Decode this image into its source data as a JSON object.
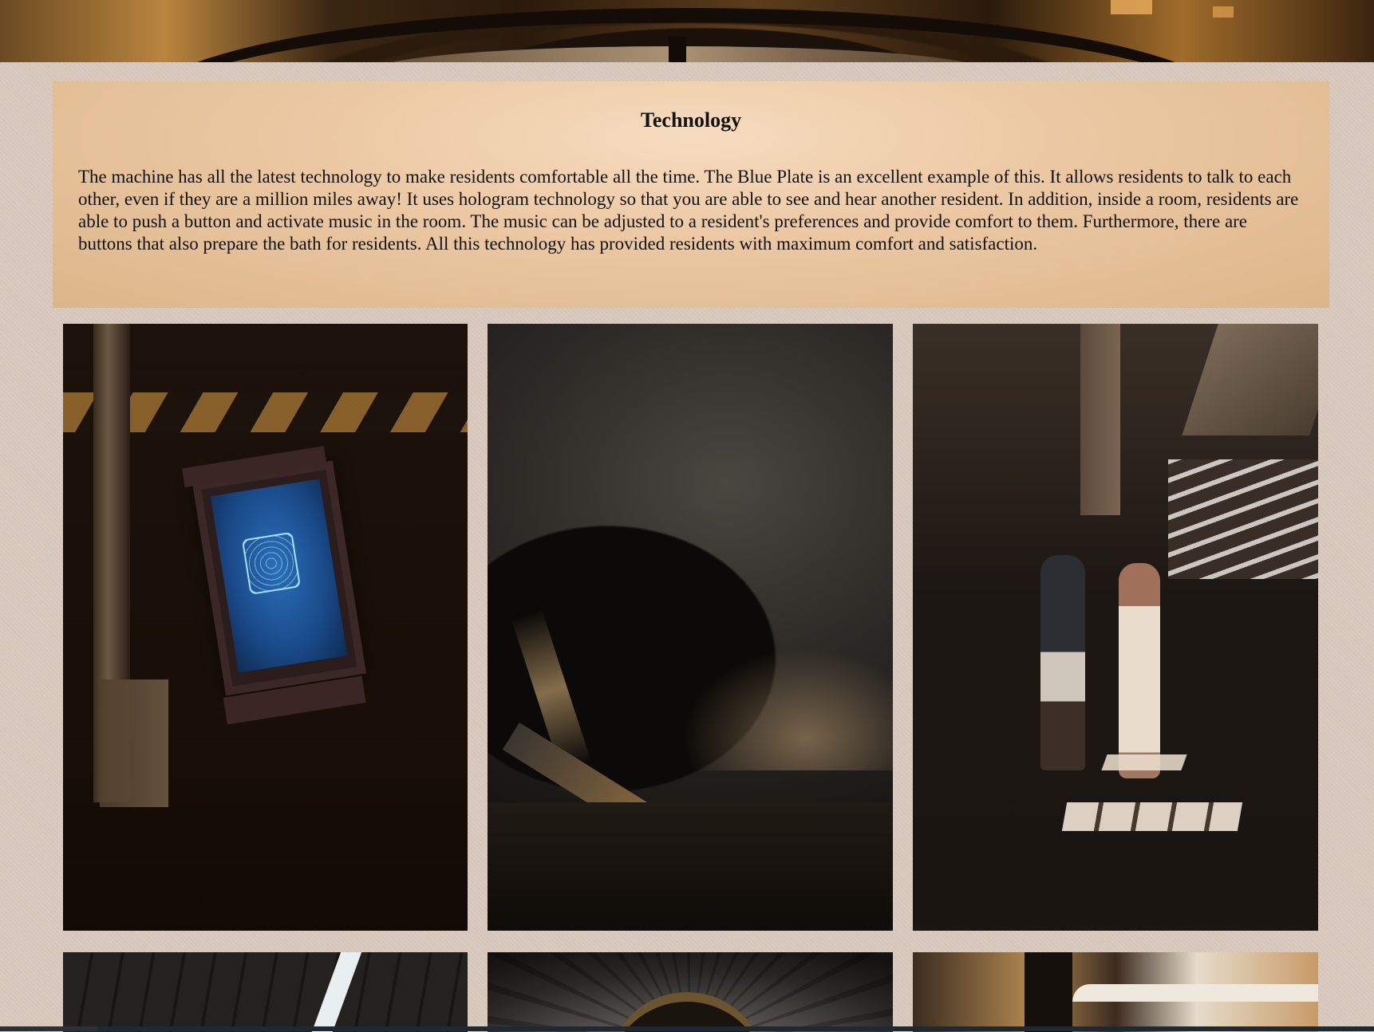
{
  "section": {
    "title": "Technology",
    "body": "The machine has all the latest technology to make residents comfortable all the time. The Blue Plate is an excellent example of this. It allows residents to talk to each other, even if they are a million miles away! It uses hologram technology so that you are able to see and hear another resident. In addition, inside a room, residents are able to push a button and activate music in the room. The music can be adjusted to a resident's preferences and provide comfort to them. Furthermore, there are buttons that also prepare the bath for residents. All this technology has provided residents with maximum comfort and satisfaction."
  },
  "colors": {
    "page_background": "#d9c9bd",
    "card_background": "#ecc9a4",
    "text": "#111111"
  },
  "gallery": {
    "photos": [
      {
        "subject": "device-with-hexagon-screen"
      },
      {
        "subject": "escalator-tunnel"
      },
      {
        "subject": "couple-dancing-in-garage"
      },
      {
        "subject": "ceiling-lights"
      },
      {
        "subject": "domed-ceiling-arch"
      },
      {
        "subject": "library-balconies"
      }
    ]
  }
}
